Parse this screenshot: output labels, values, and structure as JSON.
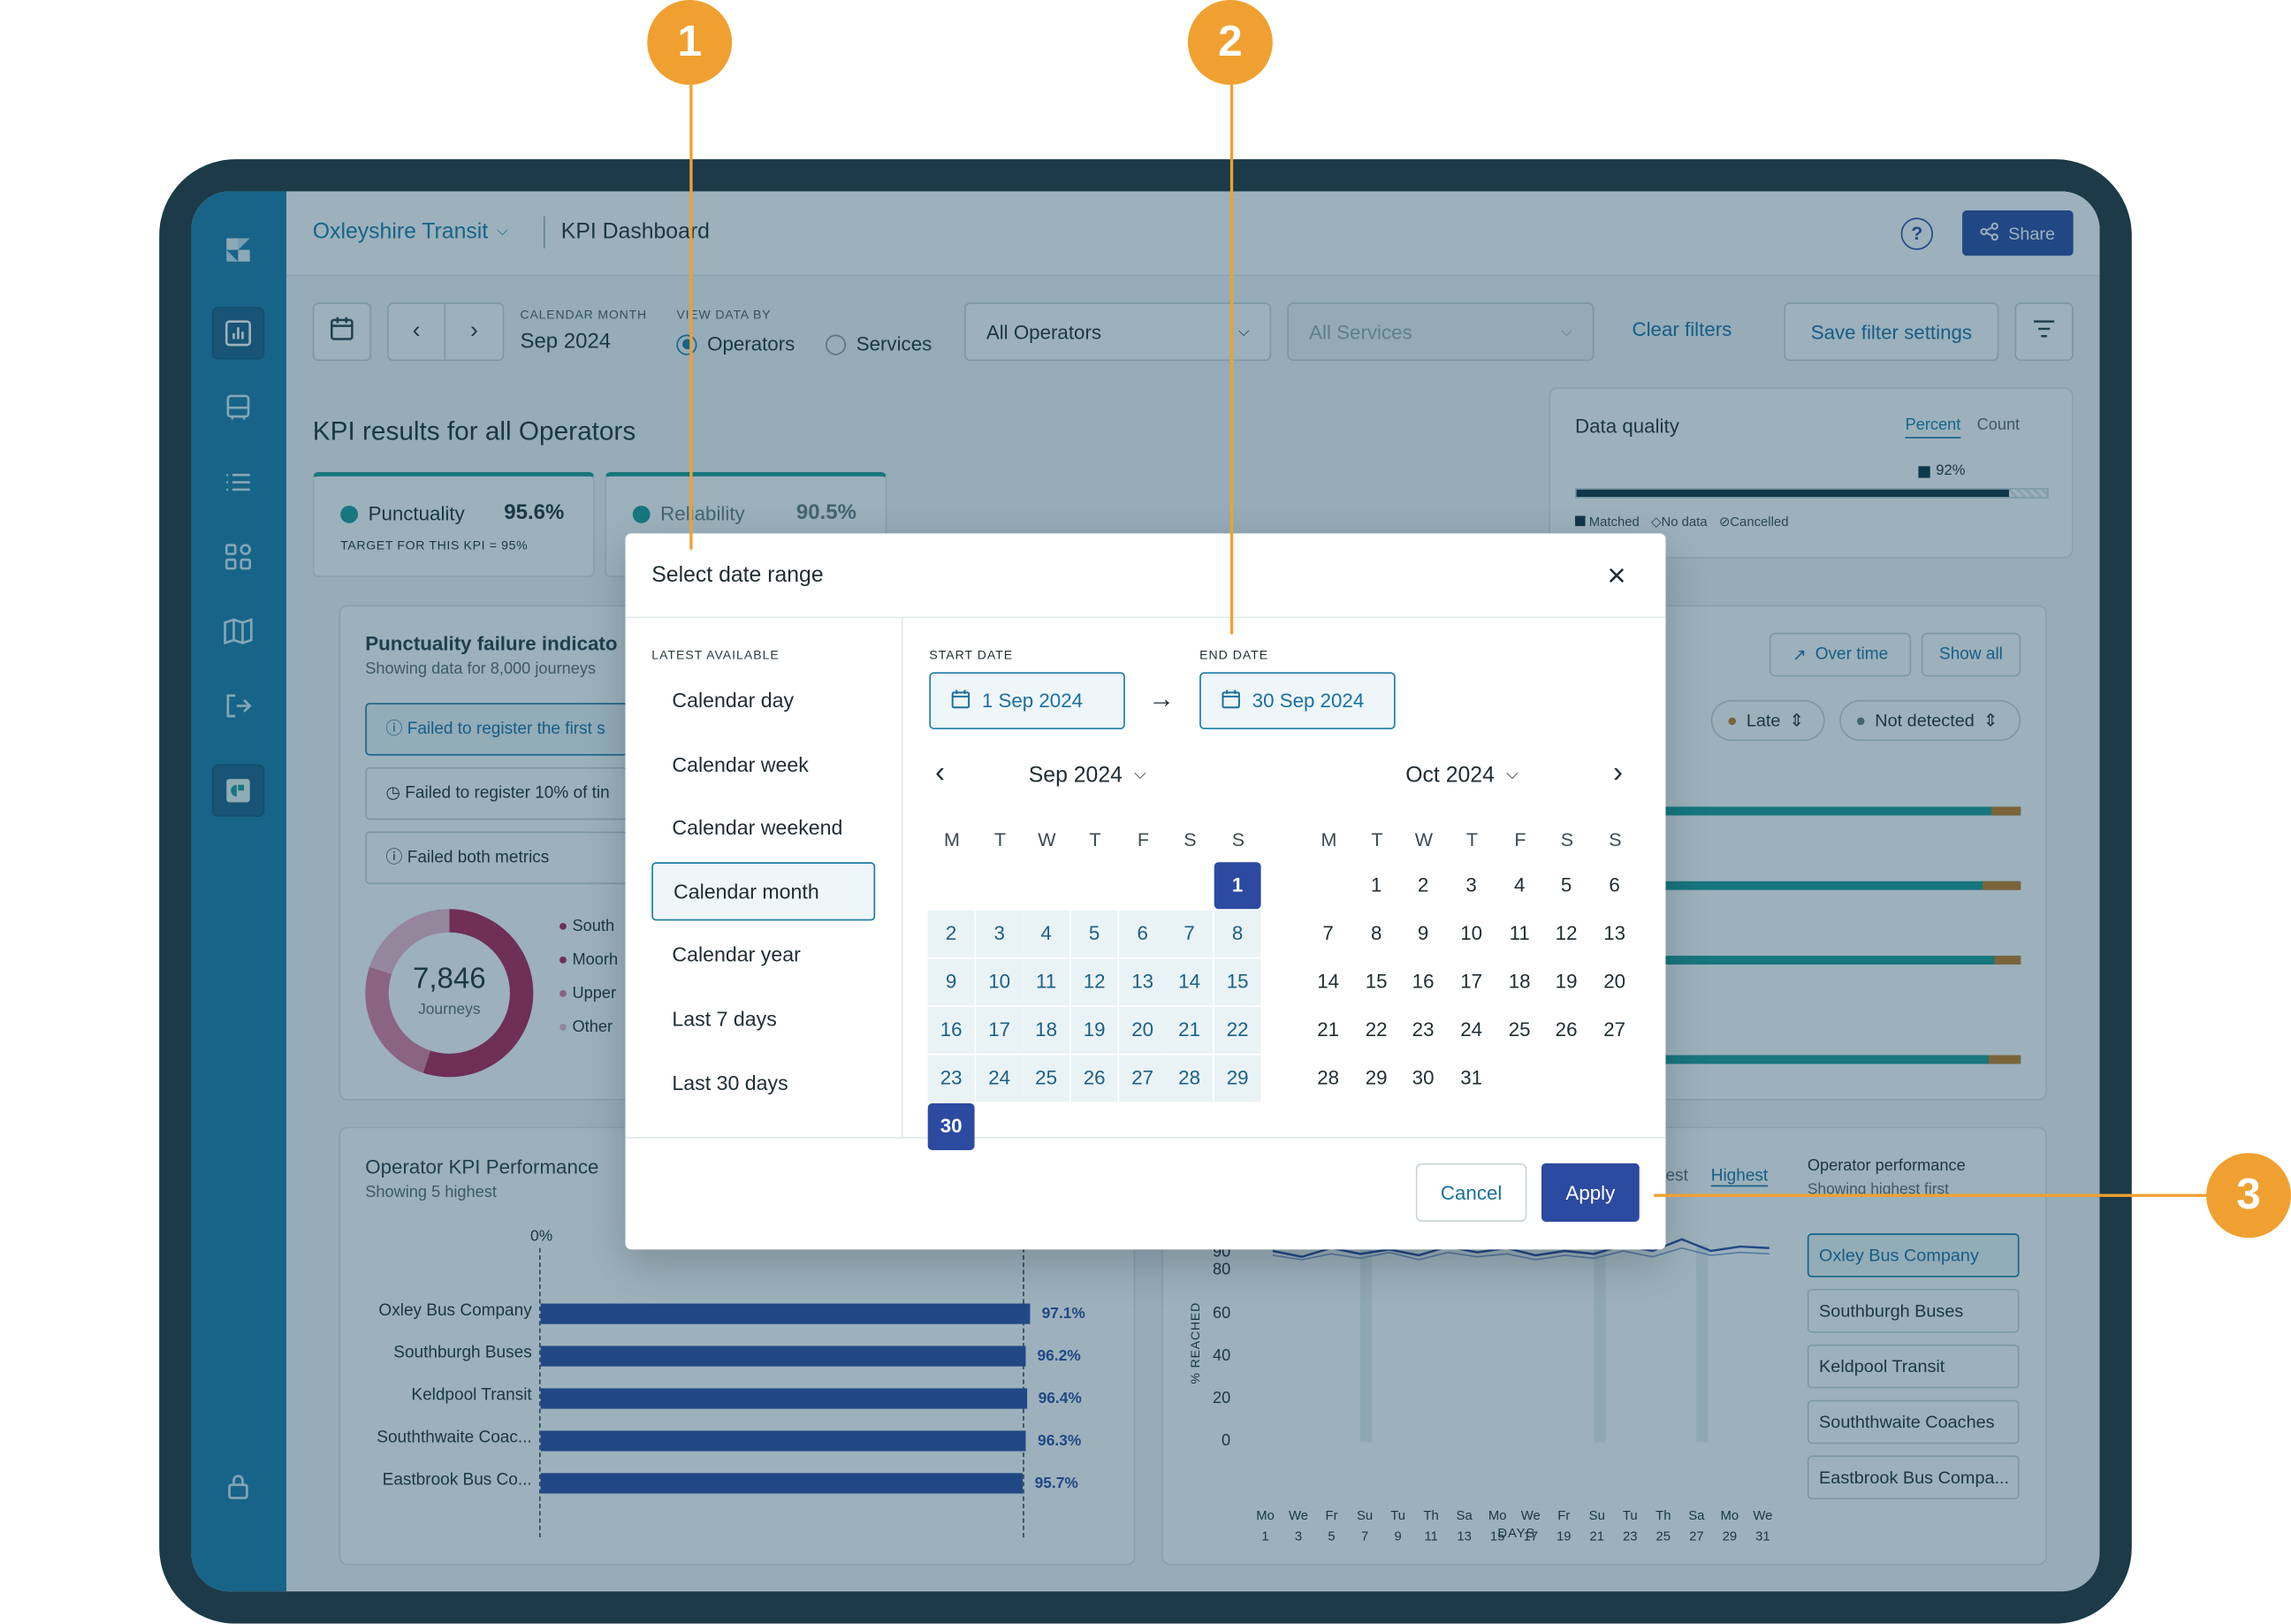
{
  "app": {
    "org": "Oxleyshire Transit",
    "page": "KPI Dashboard",
    "share": "Share"
  },
  "filters": {
    "calendar_month_label": "CALENDAR MONTH",
    "calendar_month_value": "Sep 2024",
    "view_by_label": "VIEW DATA BY",
    "view_operators": "Operators",
    "view_services": "Services",
    "operators_select": "All Operators",
    "services_select": "All Services",
    "clear": "Clear filters",
    "save": "Save filter settings"
  },
  "kpi": {
    "heading": "KPI results for all Operators",
    "punctuality_label": "Punctuality",
    "punctuality_value": "95.6%",
    "target": "TARGET FOR THIS KPI = 95%",
    "reliability_label": "Reliability",
    "reliability_value": "90.5%"
  },
  "data_quality": {
    "title": "Data quality",
    "tab_percent": "Percent",
    "tab_count": "Count",
    "matched_pct_label": "92%",
    "matched_fraction": 0.92,
    "legend": [
      "Matched",
      "No data",
      "Cancelled"
    ]
  },
  "failure": {
    "title": "Punctuality failure indicato",
    "subtitle": "Showing data for 8,000 journeys",
    "items": [
      "Failed to register the first s",
      "Failed to register 10% of tin",
      "Failed both metrics"
    ],
    "donut_value": "7,846",
    "donut_label": "Journeys",
    "legend": [
      "South",
      "Moorh",
      "Upper",
      "Other"
    ]
  },
  "right_panel": {
    "over_time": "Over time",
    "show_all": "Show all",
    "chip_late": "Late",
    "chip_not_detected": "Not detected"
  },
  "operator_perf": {
    "title": "Operator KPI Performance",
    "subtitle": "Showing 5 highest",
    "axis_zero": "0%",
    "chart_data": {
      "type": "bar",
      "categories": [
        "Oxley Bus Company",
        "Southburgh Buses",
        "Keldpool Transit",
        "Souththwaite Coac...",
        "Eastbrook Bus Co..."
      ],
      "values": [
        97.1,
        96.2,
        96.4,
        96.3,
        95.7
      ],
      "labels": [
        "97.1%",
        "96.2%",
        "96.4%",
        "96.3%",
        "95.7%"
      ]
    }
  },
  "trend": {
    "tab_lowest_partial": "est",
    "tab_highest": "Highest",
    "ylabel": "% REACHED",
    "xlabel": "DAYS",
    "yticks": [
      "90",
      "80",
      "60",
      "40",
      "20",
      "0"
    ],
    "xdays": [
      "Mo",
      "We",
      "Fr",
      "Su",
      "Tu",
      "Th",
      "Sa",
      "Mo",
      "We",
      "Fr",
      "Su",
      "Tu",
      "Th",
      "Sa",
      "Mo",
      "We"
    ],
    "xnums": [
      "1",
      "3",
      "5",
      "7",
      "9",
      "11",
      "13",
      "15",
      "17",
      "19",
      "21",
      "23",
      "25",
      "27",
      "29",
      "31"
    ],
    "perf_title": "Operator performance",
    "perf_subtitle": "Showing highest first",
    "operators": [
      "Oxley Bus Company",
      "Southburgh Buses",
      "Keldpool Transit",
      "Souththwaite Coaches",
      "Eastbrook Bus Compa..."
    ]
  },
  "modal": {
    "title": "Select date range",
    "latest_label": "LATEST AVAILABLE",
    "presets": [
      "Calendar day",
      "Calendar week",
      "Calendar weekend",
      "Calendar month",
      "Calendar year",
      "Last 7 days",
      "Last 30 days"
    ],
    "selected_preset": "Calendar month",
    "start_label": "START DATE",
    "start_value": "1 Sep 2024",
    "end_label": "END DATE",
    "end_value": "30 Sep 2024",
    "left_month": "Sep 2024",
    "right_month": "Oct 2024",
    "weekdays": [
      "M",
      "T",
      "W",
      "T",
      "F",
      "S",
      "S"
    ],
    "cancel": "Cancel",
    "apply": "Apply"
  },
  "callouts": [
    "1",
    "2",
    "3"
  ],
  "colors": {
    "accent": "#2c4aa0",
    "teal": "#1a9a94",
    "sidebar": "#1a7aa6",
    "callout": "#f0a030",
    "frame": "#1c3a48"
  }
}
